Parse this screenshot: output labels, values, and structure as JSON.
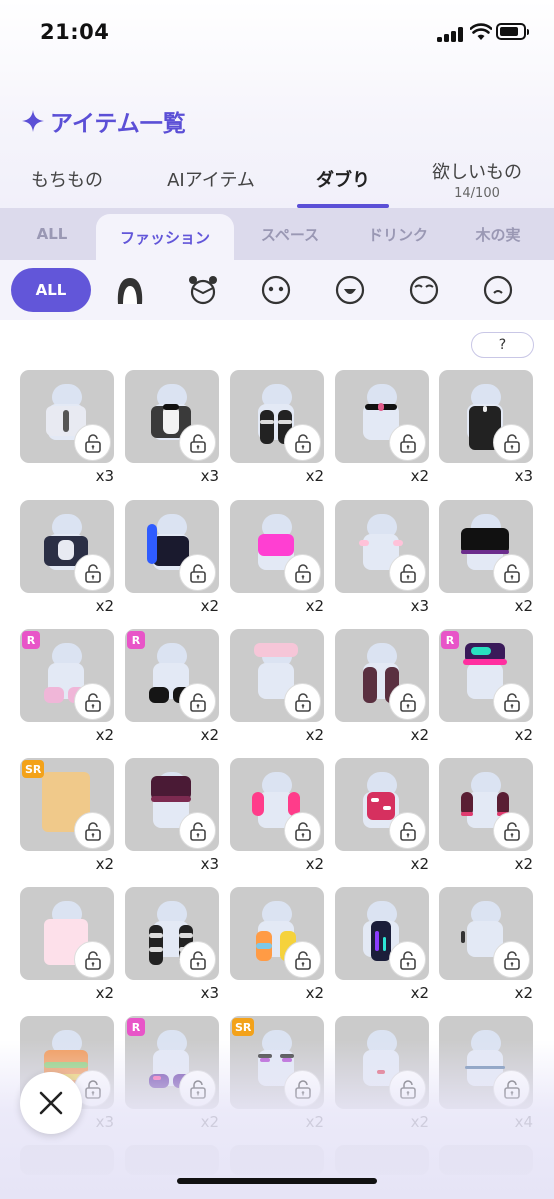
{
  "status": {
    "time": "21:04"
  },
  "title": "アイテム一覧",
  "main_tabs": [
    {
      "label": "もちもの",
      "sub": ""
    },
    {
      "label": "AIアイテム",
      "sub": ""
    },
    {
      "label": "ダブり",
      "sub": ""
    },
    {
      "label": "欲しいもの",
      "sub": "14/100"
    }
  ],
  "category_tabs": [
    "ALL",
    "ファッション",
    "スペース",
    "ドリンク",
    "木の実"
  ],
  "filters": {
    "all_label": "ALL",
    "icons": [
      "hair-icon",
      "head-accessory-icon",
      "eyes-icon",
      "mouth-icon",
      "eyebrows-icon",
      "face-icon"
    ]
  },
  "help_label": "?",
  "items": [
    {
      "qty": "x3",
      "badge": "",
      "kind": "jacket-white"
    },
    {
      "qty": "x3",
      "badge": "",
      "kind": "tuxedo"
    },
    {
      "qty": "x2",
      "badge": "",
      "kind": "boots-black"
    },
    {
      "qty": "x2",
      "badge": "",
      "kind": "choker"
    },
    {
      "qty": "x3",
      "badge": "",
      "kind": "pants-black"
    },
    {
      "qty": "x2",
      "badge": "",
      "kind": "jacket-black"
    },
    {
      "qty": "x2",
      "badge": "",
      "kind": "bag-blue"
    },
    {
      "qty": "x2",
      "badge": "",
      "kind": "top-pink"
    },
    {
      "qty": "x3",
      "badge": "",
      "kind": "blush"
    },
    {
      "qty": "x2",
      "badge": "",
      "kind": "skirt-black"
    },
    {
      "qty": "x2",
      "badge": "R",
      "kind": "shoes-pink"
    },
    {
      "qty": "x2",
      "badge": "R",
      "kind": "shoes-black"
    },
    {
      "qty": "x2",
      "badge": "",
      "kind": "braid-hair"
    },
    {
      "qty": "x2",
      "badge": "",
      "kind": "socks-brown"
    },
    {
      "qty": "x2",
      "badge": "R",
      "kind": "cap"
    },
    {
      "qty": "x2",
      "badge": "SR",
      "kind": "hair-blonde"
    },
    {
      "qty": "x3",
      "badge": "",
      "kind": "skirt-plum"
    },
    {
      "qty": "x2",
      "badge": "",
      "kind": "sleeves-pink"
    },
    {
      "qty": "x2",
      "badge": "",
      "kind": "vest-check"
    },
    {
      "qty": "x2",
      "badge": "",
      "kind": "sleeves-dark"
    },
    {
      "qty": "x2",
      "badge": "",
      "kind": "dress-pink"
    },
    {
      "qty": "x3",
      "badge": "",
      "kind": "stockings-stripe"
    },
    {
      "qty": "x2",
      "badge": "",
      "kind": "legwarmers"
    },
    {
      "qty": "x2",
      "badge": "",
      "kind": "shirt-galaxy"
    },
    {
      "qty": "x2",
      "badge": "",
      "kind": "earring"
    },
    {
      "qty": "x3",
      "badge": "",
      "kind": "sweater-rainbow"
    },
    {
      "qty": "x2",
      "badge": "R",
      "kind": "sneakers-purple"
    },
    {
      "qty": "x2",
      "badge": "SR",
      "kind": "lashes"
    },
    {
      "qty": "x2",
      "badge": "",
      "kind": "lips"
    },
    {
      "qty": "x4",
      "badge": "",
      "kind": "necklace"
    }
  ],
  "colors": {
    "accent": "#5b4fd6",
    "card_bg": "#cbcbcb",
    "badge_r": "#e855c8",
    "badge_sr": "#f3a21a"
  },
  "close_button": "close-icon"
}
